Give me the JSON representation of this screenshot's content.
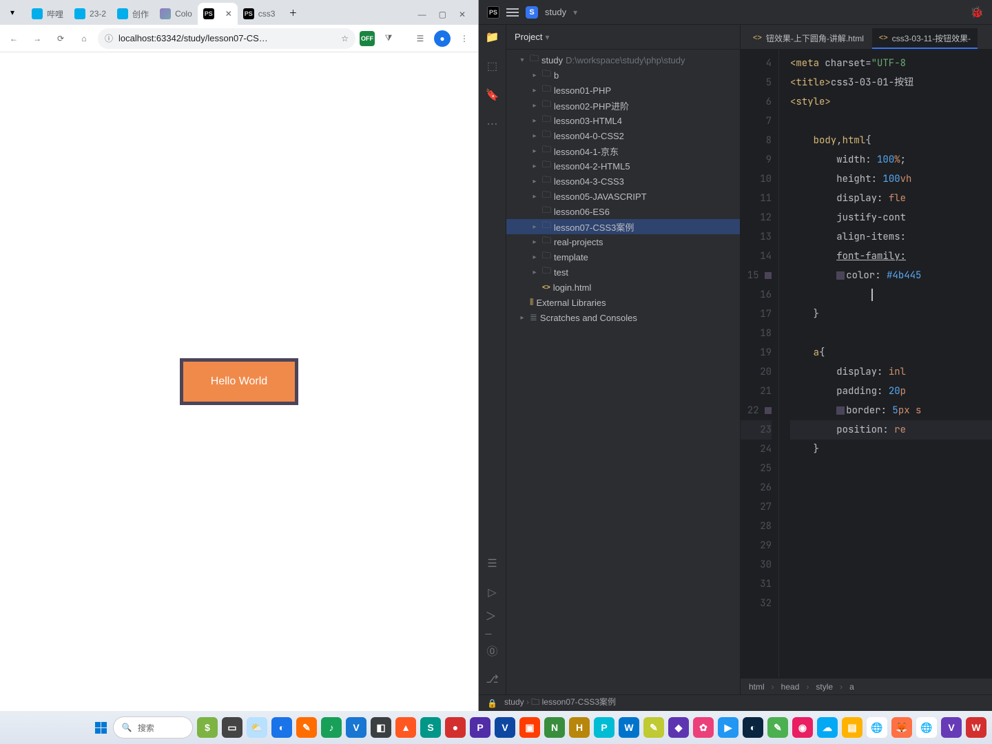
{
  "browser": {
    "tabs": [
      {
        "label": "哔哩",
        "favicon": "bili"
      },
      {
        "label": "23-2",
        "favicon": "bili"
      },
      {
        "label": "创作",
        "favicon": "bili"
      },
      {
        "label": "Colo",
        "favicon": "color"
      },
      {
        "label": "",
        "favicon": "ps",
        "active": true
      },
      {
        "label": "css3",
        "favicon": "ps"
      }
    ],
    "url": "localhost:63342/study/lesson07-CS…",
    "page_button": "Hello World",
    "ext_off": "OFF"
  },
  "ide": {
    "project_name": "study",
    "project_panel_title": "Project",
    "root_path": "D:\\workspace\\study\\php\\study",
    "tree": [
      {
        "depth": 0,
        "chev": "down",
        "icon": "folder",
        "label": "study",
        "extra": "D:\\workspace\\study\\php\\study"
      },
      {
        "depth": 1,
        "chev": "right",
        "icon": "folder",
        "label": "b"
      },
      {
        "depth": 1,
        "chev": "right",
        "icon": "folder",
        "label": "lesson01-PHP"
      },
      {
        "depth": 1,
        "chev": "right",
        "icon": "folder",
        "label": "lesson02-PHP进阶"
      },
      {
        "depth": 1,
        "chev": "right",
        "icon": "folder",
        "label": "lesson03-HTML4"
      },
      {
        "depth": 1,
        "chev": "right",
        "icon": "folder",
        "label": "lesson04-0-CSS2"
      },
      {
        "depth": 1,
        "chev": "right",
        "icon": "folder",
        "label": "lesson04-1-京东"
      },
      {
        "depth": 1,
        "chev": "right",
        "icon": "folder",
        "label": "lesson04-2-HTML5"
      },
      {
        "depth": 1,
        "chev": "right",
        "icon": "folder",
        "label": "lesson04-3-CSS3"
      },
      {
        "depth": 1,
        "chev": "right",
        "icon": "folder",
        "label": "lesson05-JAVASCRIPT"
      },
      {
        "depth": 1,
        "chev": "none",
        "icon": "folder",
        "label": "lesson06-ES6"
      },
      {
        "depth": 1,
        "chev": "right",
        "icon": "folder",
        "label": "lesson07-CSS3案例",
        "selected": true
      },
      {
        "depth": 1,
        "chev": "right",
        "icon": "folder",
        "label": "real-projects"
      },
      {
        "depth": 1,
        "chev": "right",
        "icon": "folder",
        "label": "template"
      },
      {
        "depth": 1,
        "chev": "right",
        "icon": "folder",
        "label": "test"
      },
      {
        "depth": 1,
        "chev": "none",
        "icon": "html",
        "label": "login.html"
      },
      {
        "depth": 0,
        "chev": "none",
        "icon": "lib",
        "label": "External Libraries"
      },
      {
        "depth": 0,
        "chev": "right",
        "icon": "scratch",
        "label": "Scratches and Consoles"
      }
    ],
    "editor_tabs": [
      {
        "label": "钮效果-上下圆角-讲解.html"
      },
      {
        "label": "css3-03-11-按钮效果-",
        "active": true
      }
    ],
    "code_lines": [
      {
        "n": 4,
        "html": "<span class='tag'>&lt;meta</span> <span class='attr'>charset=</span><span class='val'>\"UTF-8</span>"
      },
      {
        "n": 5,
        "html": "<span class='tag'>&lt;title&gt;</span>css3-03-01-按钮"
      },
      {
        "n": 6,
        "html": "<span class='tag'>&lt;style&gt;</span>"
      },
      {
        "n": 7,
        "html": ""
      },
      {
        "n": 8,
        "html": "    <span class='sel'>body</span>,<span class='sel'>html</span><span class='brace'>{</span>"
      },
      {
        "n": 9,
        "html": "        <span class='prop'>width:</span> <span class='num'>100</span><span class='kw'>%</span>;"
      },
      {
        "n": 10,
        "html": "        <span class='prop'>height:</span> <span class='num'>100</span><span class='kw'>vh</span>"
      },
      {
        "n": 11,
        "html": "        <span class='prop'>display:</span> <span class='kw'>fle</span>"
      },
      {
        "n": 12,
        "html": "        <span class='prop'>justify-cont</span>"
      },
      {
        "n": 13,
        "html": "        <span class='prop'>align-items:</span>"
      },
      {
        "n": 14,
        "html": "        <span class='prop'><u>font-family:</u></span>"
      },
      {
        "n": 15,
        "html": "        <span class='colorbox' style='background:#4b4459'></span><span class='prop'>color:</span> <span class='hex'>#4b445</span>",
        "mark": true
      },
      {
        "n": 16,
        "html": "              <span class='cursor'></span>"
      },
      {
        "n": 17,
        "html": "    <span class='brace'>}</span>"
      },
      {
        "n": 18,
        "html": ""
      },
      {
        "n": 19,
        "html": "    <span class='sel'>a</span><span class='brace'>{</span>"
      },
      {
        "n": 20,
        "html": "        <span class='prop'>display:</span> <span class='kw'>inl</span>"
      },
      {
        "n": 21,
        "html": "        <span class='prop'>padding:</span> <span class='num'>20</span><span class='kw'>p</span>"
      },
      {
        "n": 22,
        "html": "        <span class='colorbox' style='background:#4b4459'></span><span class='prop'>border:</span> <span class='num'>5</span><span class='kw'>px</span> <span class='kw'>s</span>",
        "mark": true
      },
      {
        "n": 23,
        "html": "        <span class='prop'>position:</span> <span class='kw'>re</span>",
        "hl": true
      },
      {
        "n": 24,
        "html": "    <span class='brace'>}</span>"
      },
      {
        "n": 25,
        "html": ""
      },
      {
        "n": 26,
        "html": ""
      },
      {
        "n": 27,
        "html": ""
      },
      {
        "n": 28,
        "html": ""
      },
      {
        "n": 29,
        "html": ""
      },
      {
        "n": 30,
        "html": ""
      },
      {
        "n": 31,
        "html": ""
      },
      {
        "n": 32,
        "html": ""
      }
    ],
    "breadcrumb": [
      "html",
      "head",
      "style",
      "a"
    ],
    "status_path": [
      "study",
      "lesson07-CSS3案例"
    ]
  },
  "taskbar": {
    "search_placeholder": "搜索",
    "apps": [
      {
        "bg": "#7cb342",
        "t": "$"
      },
      {
        "bg": "#444",
        "t": "▭"
      },
      {
        "bg": "#b8e0ff",
        "t": "⛅"
      },
      {
        "bg": "#1a73e8",
        "t": "◐"
      },
      {
        "bg": "#ff6d00",
        "t": "✎"
      },
      {
        "bg": "#18a058",
        "t": "♪"
      },
      {
        "bg": "#1976d2",
        "t": "V"
      },
      {
        "bg": "#3c3f41",
        "t": "◧"
      },
      {
        "bg": "#ff5722",
        "t": "▲"
      },
      {
        "bg": "#009688",
        "t": "S"
      },
      {
        "bg": "#d32f2f",
        "t": "●"
      },
      {
        "bg": "#512da8",
        "t": "P"
      },
      {
        "bg": "#0d47a1",
        "t": "V"
      },
      {
        "bg": "#ff3d00",
        "t": "▣"
      },
      {
        "bg": "#388e3c",
        "t": "N"
      },
      {
        "bg": "#b8860b",
        "t": "H"
      },
      {
        "bg": "#00bcd4",
        "t": "P"
      },
      {
        "bg": "#0074cc",
        "t": "W"
      },
      {
        "bg": "#c0ca33",
        "t": "✎"
      },
      {
        "bg": "#5e35b1",
        "t": "◆"
      },
      {
        "bg": "#ec407a",
        "t": "✿"
      },
      {
        "bg": "#2196f3",
        "t": "▶"
      },
      {
        "bg": "#0a2540",
        "t": "◐"
      },
      {
        "bg": "#4caf50",
        "t": "✎"
      },
      {
        "bg": "#e91e63",
        "t": "◉"
      },
      {
        "bg": "#03a9f4",
        "t": "☁"
      },
      {
        "bg": "#ffb300",
        "t": "▤"
      },
      {
        "bg": "#ffffff",
        "t": "🌐",
        "fg": "#333"
      },
      {
        "bg": "#ff7043",
        "t": "🦊"
      },
      {
        "bg": "#ffffff",
        "t": "🌐",
        "fg": "#333"
      },
      {
        "bg": "#673ab7",
        "t": "V"
      },
      {
        "bg": "#d32f2f",
        "t": "W"
      }
    ]
  }
}
